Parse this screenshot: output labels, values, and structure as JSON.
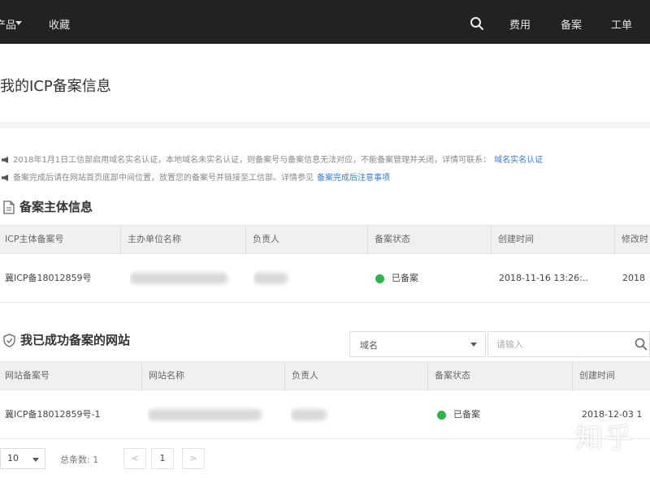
{
  "topbar": {
    "menu_label": "产品",
    "favorites_label": "收藏",
    "fee_label": "费用",
    "beian_label": "备案",
    "ticket_label": "工单",
    "background": "#222222"
  },
  "page": {
    "title": "我的ICP备案信息"
  },
  "notices": [
    {
      "text": "2018年1月1日工信部启用域名实名认证，本地域名未实名认证，则备案号与备案信息无法对应，不能备案管理并关闭，详情可联系：",
      "link": "域名实名认证"
    },
    {
      "text": "备案完成后请在网站首页底部中间位置，放置您的备案号并链接至工信部。详情参见",
      "link": "备案完成后注意事项"
    }
  ],
  "subject_section": {
    "title": "备案主体信息",
    "columns": [
      "ICP主体备案号",
      "主办单位名称",
      "负责人",
      "备案状态",
      "创建时间",
      "修改时"
    ],
    "row": {
      "icp_no": "冀ICP备18012859号",
      "status": "已备案",
      "created": "2018-11-16 13:26:..",
      "modified": "2018"
    }
  },
  "site_section": {
    "title": "我已成功备案的网站",
    "filter": {
      "select_value": "域名",
      "search_placeholder": "请输入"
    },
    "columns": [
      "网站备案号",
      "网站名称",
      "负责人",
      "备案状态",
      "创建时间"
    ],
    "row": {
      "site_no": "冀ICP备18012859号-1",
      "status": "已备案",
      "created": "2018-12-03 1"
    }
  },
  "pagination": {
    "page_size": "10",
    "total_label": "总条数: 1",
    "prev": "<",
    "current": "1",
    "next": ">"
  },
  "watermark": "知乎",
  "colors": {
    "success": "#2fb24b",
    "link": "#3a7bd5",
    "header_bg": "#f0f0f0"
  },
  "icons": {
    "search": "search-icon",
    "document": "document-icon",
    "shield": "shield-check-icon",
    "speaker": "speaker-icon"
  }
}
